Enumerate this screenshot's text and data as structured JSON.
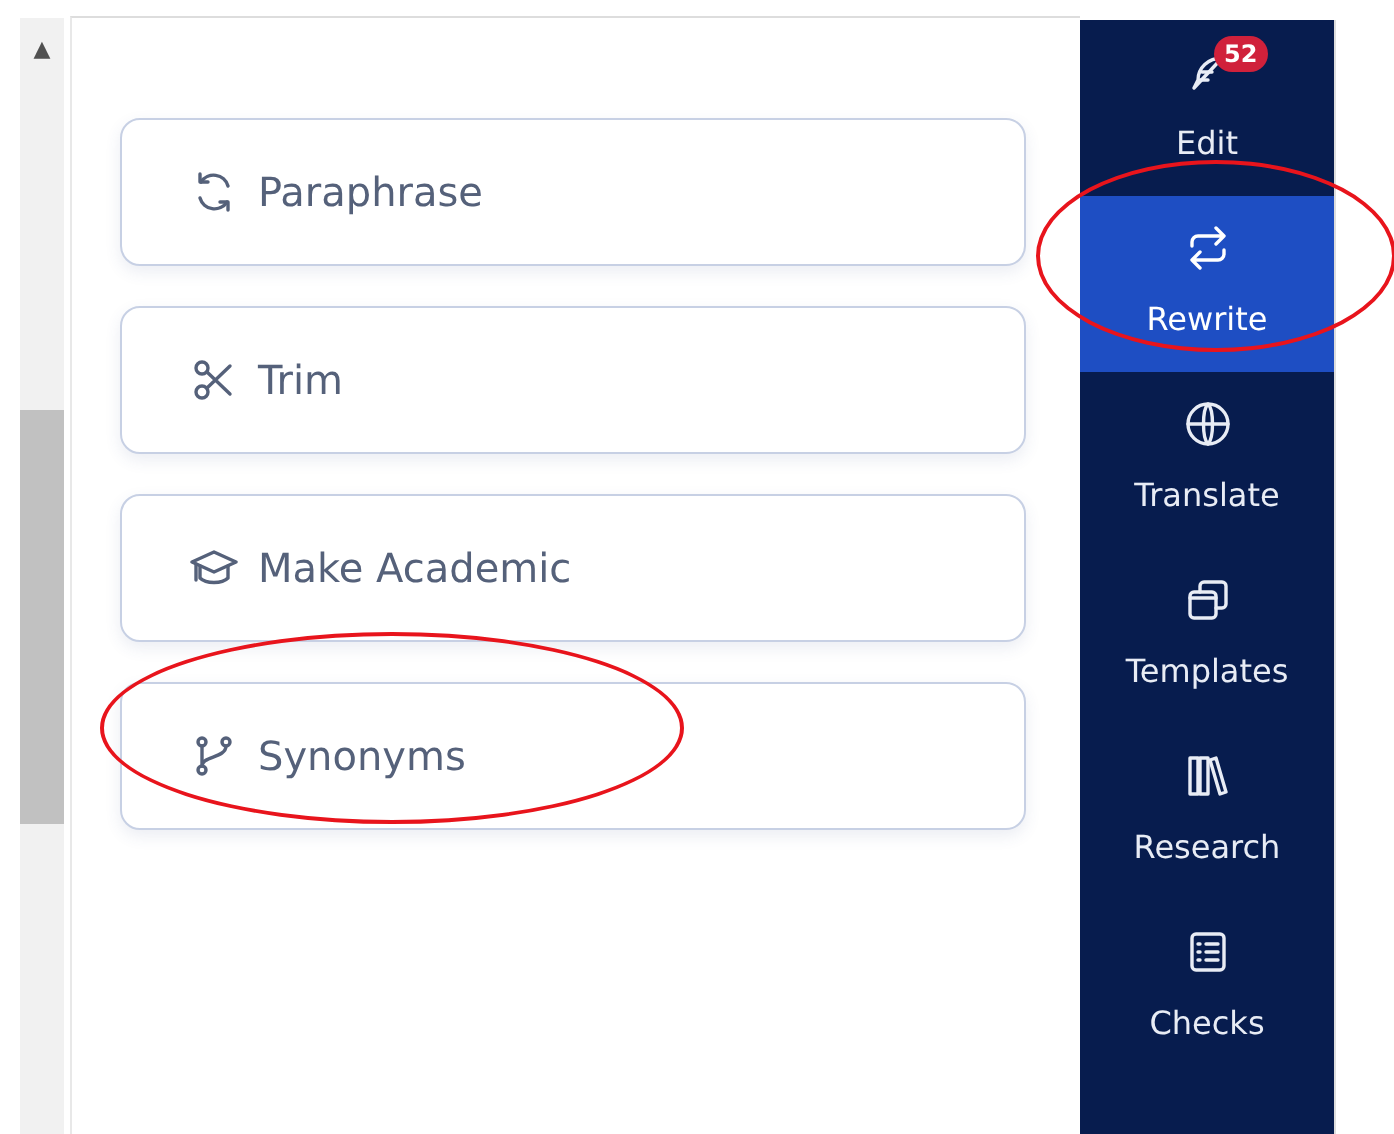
{
  "scrollbar": {
    "arrow": "▲"
  },
  "options": [
    {
      "label": "Paraphrase",
      "highlighted": false
    },
    {
      "label": "Trim",
      "highlighted": false
    },
    {
      "label": "Make Academic",
      "highlighted": false
    },
    {
      "label": "Synonyms",
      "highlighted": true
    }
  ],
  "sidebar": {
    "items": [
      {
        "label": "Edit",
        "badge": "52",
        "selected": false,
        "highlighted": false
      },
      {
        "label": "Rewrite",
        "selected": true,
        "highlighted": true
      },
      {
        "label": "Translate",
        "selected": false,
        "highlighted": false
      },
      {
        "label": "Templates",
        "selected": false,
        "highlighted": false
      },
      {
        "label": "Research",
        "selected": false,
        "highlighted": false
      },
      {
        "label": "Checks",
        "selected": false,
        "highlighted": false
      }
    ]
  }
}
